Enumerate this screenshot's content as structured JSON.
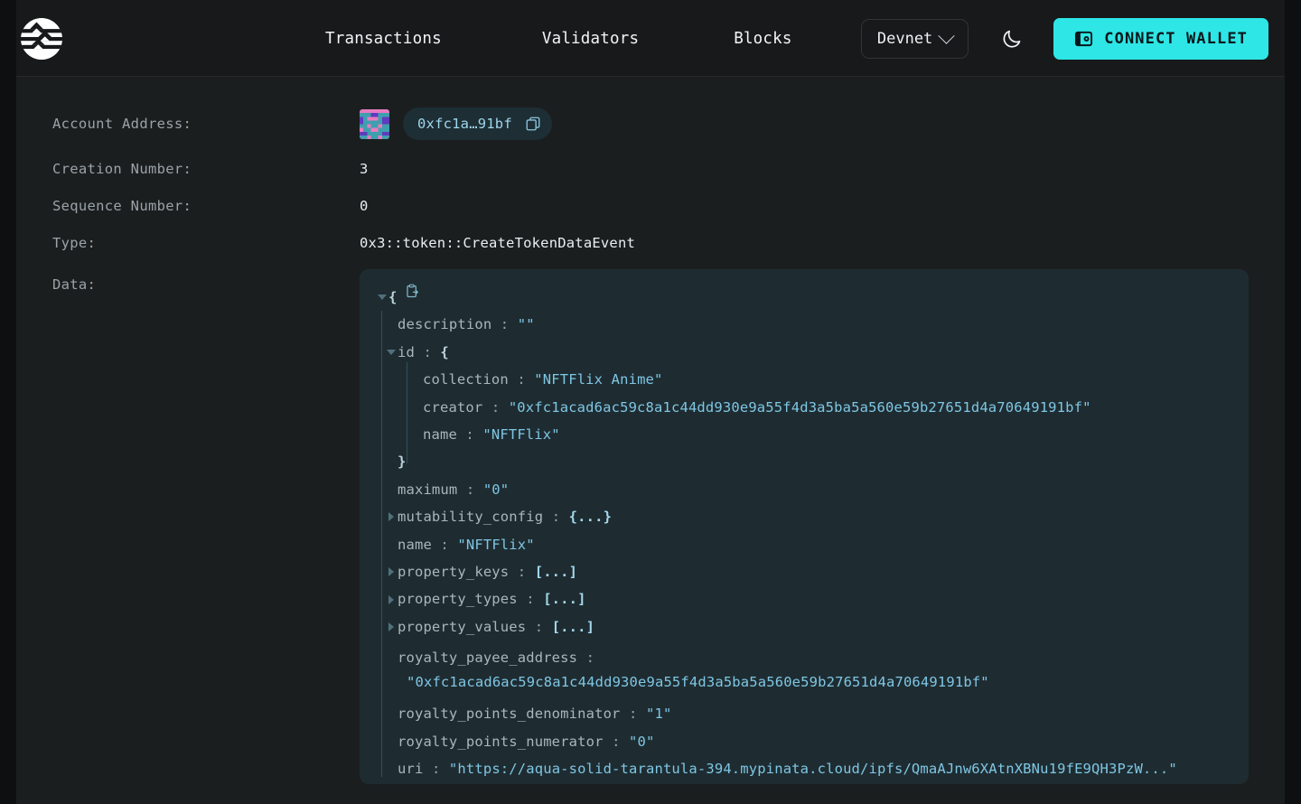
{
  "header": {
    "logo_name": "aptos-logo",
    "nav": [
      {
        "label": "Transactions"
      },
      {
        "label": "Validators"
      },
      {
        "label": "Blocks"
      }
    ],
    "network": {
      "label": "Devnet",
      "chevron": "chevron-down-icon"
    },
    "theme_toggle": {
      "icon": "moon-icon"
    },
    "connect_wallet": {
      "label": "CONNECT WALLET",
      "icon": "wallet-icon"
    }
  },
  "colors": {
    "accent": "#2ee6e6",
    "page_bg": "#1b1e1f",
    "header_bg": "#17191a",
    "json_panel_bg": "#1e2c31",
    "chip_bg": "#1d2e35",
    "string_value": "#7fc6e4",
    "key_text": "#a9b6bc",
    "label_text": "#9aa3a8"
  },
  "details": {
    "account_address": {
      "label": "Account Address:",
      "value_short": "0xfc1a…91bf",
      "copy_icon": "copy-icon",
      "avatar": "identicon-avatar"
    },
    "creation_number": {
      "label": "Creation Number:",
      "value": "3"
    },
    "sequence_number": {
      "label": "Sequence Number:",
      "value": "0"
    },
    "type": {
      "label": "Type:",
      "value": "0x3::token::CreateTokenDataEvent"
    },
    "data": {
      "label": "Data:"
    }
  },
  "json_viewer": {
    "copy_icon": "clipboard-copy-icon",
    "open_brace": "{",
    "close_brace": "}",
    "lines": [
      {
        "key": "description",
        "sep": ":",
        "value": "\"\""
      },
      {
        "key": "id",
        "sep": ":",
        "value": "{"
      },
      {
        "key": "collection",
        "sep": ":",
        "value": "\"NFTFlix Anime\""
      },
      {
        "key": "creator",
        "sep": ":",
        "value": "\"0xfc1acad6ac59c8a1c44dd930e9a55f4d3a5ba5a560e59b27651d4a70649191bf\""
      },
      {
        "key": "name",
        "sep": ":",
        "value": "\"NFTFlix\""
      },
      {
        "key": "",
        "sep": "",
        "value": "}"
      },
      {
        "key": "maximum",
        "sep": ":",
        "value": "\"0\""
      },
      {
        "key": "mutability_config",
        "sep": ":",
        "value": "{...}"
      },
      {
        "key": "name",
        "sep": ":",
        "value": "\"NFTFlix\""
      },
      {
        "key": "property_keys",
        "sep": ":",
        "value": "[...]"
      },
      {
        "key": "property_types",
        "sep": ":",
        "value": "[...]"
      },
      {
        "key": "property_values",
        "sep": ":",
        "value": "[...]"
      },
      {
        "key": "royalty_payee_address",
        "sep": ":",
        "value": "\"0xfc1acad6ac59c8a1c44dd930e9a55f4d3a5ba5a560e59b27651d4a70649191bf\""
      },
      {
        "key": "royalty_points_denominator",
        "sep": ":",
        "value": "\"1\""
      },
      {
        "key": "royalty_points_numerator",
        "sep": ":",
        "value": "\"0\""
      },
      {
        "key": "uri",
        "sep": ":",
        "value": "\"https://aqua-solid-tarantula-394.mypinata.cloud/ipfs/QmaAJnw6XAtnXBNu19fE9QH3PzW...\""
      }
    ]
  }
}
